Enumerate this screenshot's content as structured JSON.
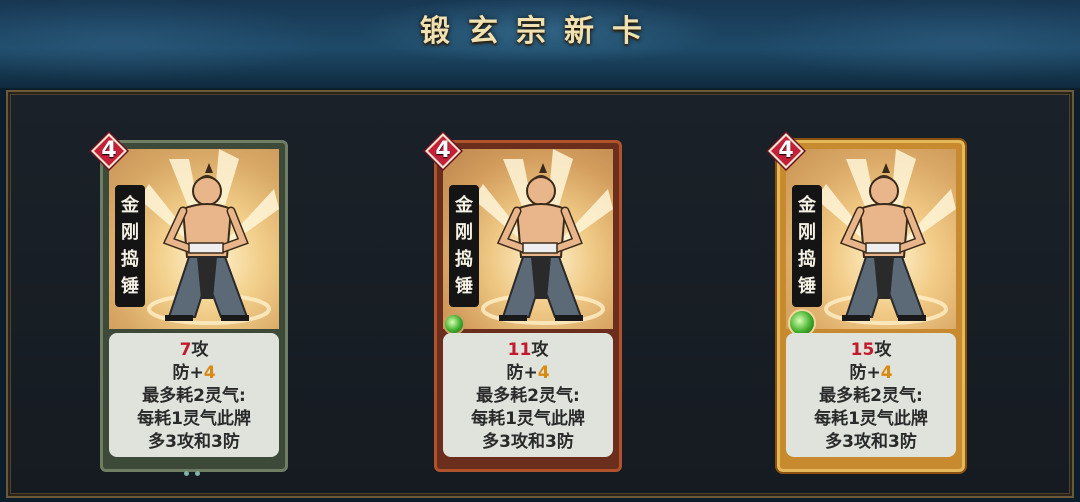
{
  "title": "锻玄宗新卡",
  "cards": [
    {
      "cost": "4",
      "name_chars": [
        "金",
        "刚",
        "捣",
        "锤"
      ],
      "attack_value": "7",
      "attack_label": "攻",
      "defense_label": "防+",
      "defense_value": "4",
      "effect_line1": "最多耗2灵气:",
      "effect_line2": "每耗1灵气此牌",
      "effect_line3": "多3攻和3防",
      "has_gem": false
    },
    {
      "cost": "4",
      "name_chars": [
        "金",
        "刚",
        "捣",
        "锤"
      ],
      "attack_value": "11",
      "attack_label": "攻",
      "defense_label": "防+",
      "defense_value": "4",
      "effect_line1": "最多耗2灵气:",
      "effect_line2": "每耗1灵气此牌",
      "effect_line3": "多3攻和3防",
      "has_gem": true
    },
    {
      "cost": "4",
      "name_chars": [
        "金",
        "刚",
        "捣",
        "锤"
      ],
      "attack_value": "15",
      "attack_label": "攻",
      "defense_label": "防+",
      "defense_value": "4",
      "effect_line1": "最多耗2灵气:",
      "effect_line2": "每耗1灵气此牌",
      "effect_line3": "多3攻和3防",
      "has_gem": true
    }
  ],
  "colors": {
    "attack": "#c21a2c",
    "defense": "#d88a12",
    "cost_badge": "#c4203a",
    "title": "#f1e0b0"
  }
}
